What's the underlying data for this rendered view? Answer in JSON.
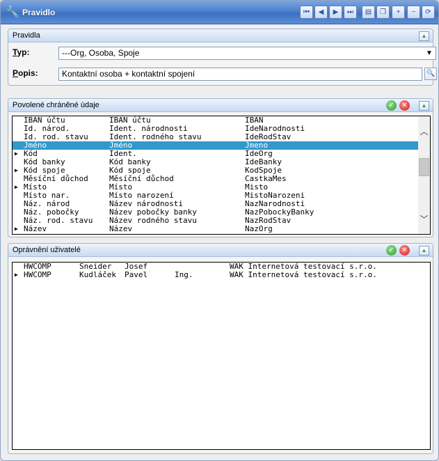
{
  "window": {
    "title": "Pravidlo",
    "icon": "wrench-icon"
  },
  "toolbar": {
    "buttons": [
      {
        "name": "first-record-button",
        "icon": "first-icon",
        "glyph": "⏮"
      },
      {
        "name": "prev-record-button",
        "icon": "prev-icon",
        "glyph": "◀"
      },
      {
        "name": "next-record-button",
        "icon": "next-icon",
        "glyph": "▶"
      },
      {
        "name": "last-record-button",
        "icon": "last-icon",
        "glyph": "⏭"
      },
      {
        "name": "detail-button",
        "icon": "detail-icon",
        "glyph": "▤"
      },
      {
        "name": "copy-button",
        "icon": "copy-icon",
        "glyph": "❐"
      },
      {
        "name": "add-button",
        "icon": "add-icon",
        "glyph": "+"
      },
      {
        "name": "delete-button",
        "icon": "delete-icon",
        "glyph": "−"
      },
      {
        "name": "refresh-button",
        "icon": "refresh-icon",
        "glyph": "⟳"
      }
    ]
  },
  "pravidla": {
    "title": "Pravidla",
    "typ_label_first": "T",
    "typ_label_rest": "yp:",
    "typ_value": "---Org, Osoba, Spoje",
    "popis_label_first": "P",
    "popis_label_rest": "opis:",
    "popis_value": "Kontaktní osoba + kontaktní spojení"
  },
  "povolene": {
    "title": "Povolené chráněné údaje",
    "rows": [
      {
        "c1": "IBAN účtu",
        "c2": "IBAN účtu",
        "c3": "IBAN",
        "marker": false,
        "selected": false
      },
      {
        "c1": "Id. národ.",
        "c2": "Ident. národnosti",
        "c3": "IdeNarodnosti",
        "marker": false,
        "selected": false
      },
      {
        "c1": "Id. rod. stavu",
        "c2": "Ident. rodného stavu",
        "c3": "IdeRodStav",
        "marker": false,
        "selected": false
      },
      {
        "c1": "Jméno",
        "c2": "Jméno",
        "c3": "Jmeno",
        "marker": false,
        "selected": true
      },
      {
        "c1": "Kód",
        "c2": "Ident.",
        "c3": "IdeOrg",
        "marker": true,
        "selected": false
      },
      {
        "c1": "Kód banky",
        "c2": "Kód banky",
        "c3": "IdeBanky",
        "marker": false,
        "selected": false
      },
      {
        "c1": "Kód spoje",
        "c2": "Kód spoje",
        "c3": "KodSpoje",
        "marker": true,
        "selected": false
      },
      {
        "c1": "Měsíční důchod",
        "c2": "Měsíční důchod",
        "c3": "CastkaMes",
        "marker": false,
        "selected": false
      },
      {
        "c1": "Místo",
        "c2": "Místo",
        "c3": "Misto",
        "marker": true,
        "selected": false
      },
      {
        "c1": "Místo nar.",
        "c2": "Místo narození",
        "c3": "MistoNarozeni",
        "marker": false,
        "selected": false
      },
      {
        "c1": "Náz. národ",
        "c2": "Název národnosti",
        "c3": "NazNarodnosti",
        "marker": false,
        "selected": false
      },
      {
        "c1": "Náz. pobočky",
        "c2": "Název pobočky banky",
        "c3": "NazPobockyBanky",
        "marker": false,
        "selected": false
      },
      {
        "c1": "Náz. rod. stavu",
        "c2": "Název rodného stavu",
        "c3": "NazRodStav",
        "marker": false,
        "selected": false
      },
      {
        "c1": "Název",
        "c2": "Název",
        "c3": "NazOrg",
        "marker": true,
        "selected": false
      }
    ]
  },
  "opravneni": {
    "title": "Oprávnění uživatelé",
    "rows": [
      {
        "c1": "HWCOMP",
        "c2": "Sneider",
        "c3": "Josef",
        "c4": "",
        "c5": "WAK Internetová testovací s.r.o.",
        "marker": false
      },
      {
        "c1": "HWCOMP",
        "c2": "Kudláček",
        "c3": "Pavel",
        "c4": "Ing.",
        "c5": "WAK Internetová testovací s.r.o.",
        "marker": true
      }
    ]
  },
  "colors": {
    "selection": "#3399cc",
    "titlebar": "#4c80cc"
  }
}
